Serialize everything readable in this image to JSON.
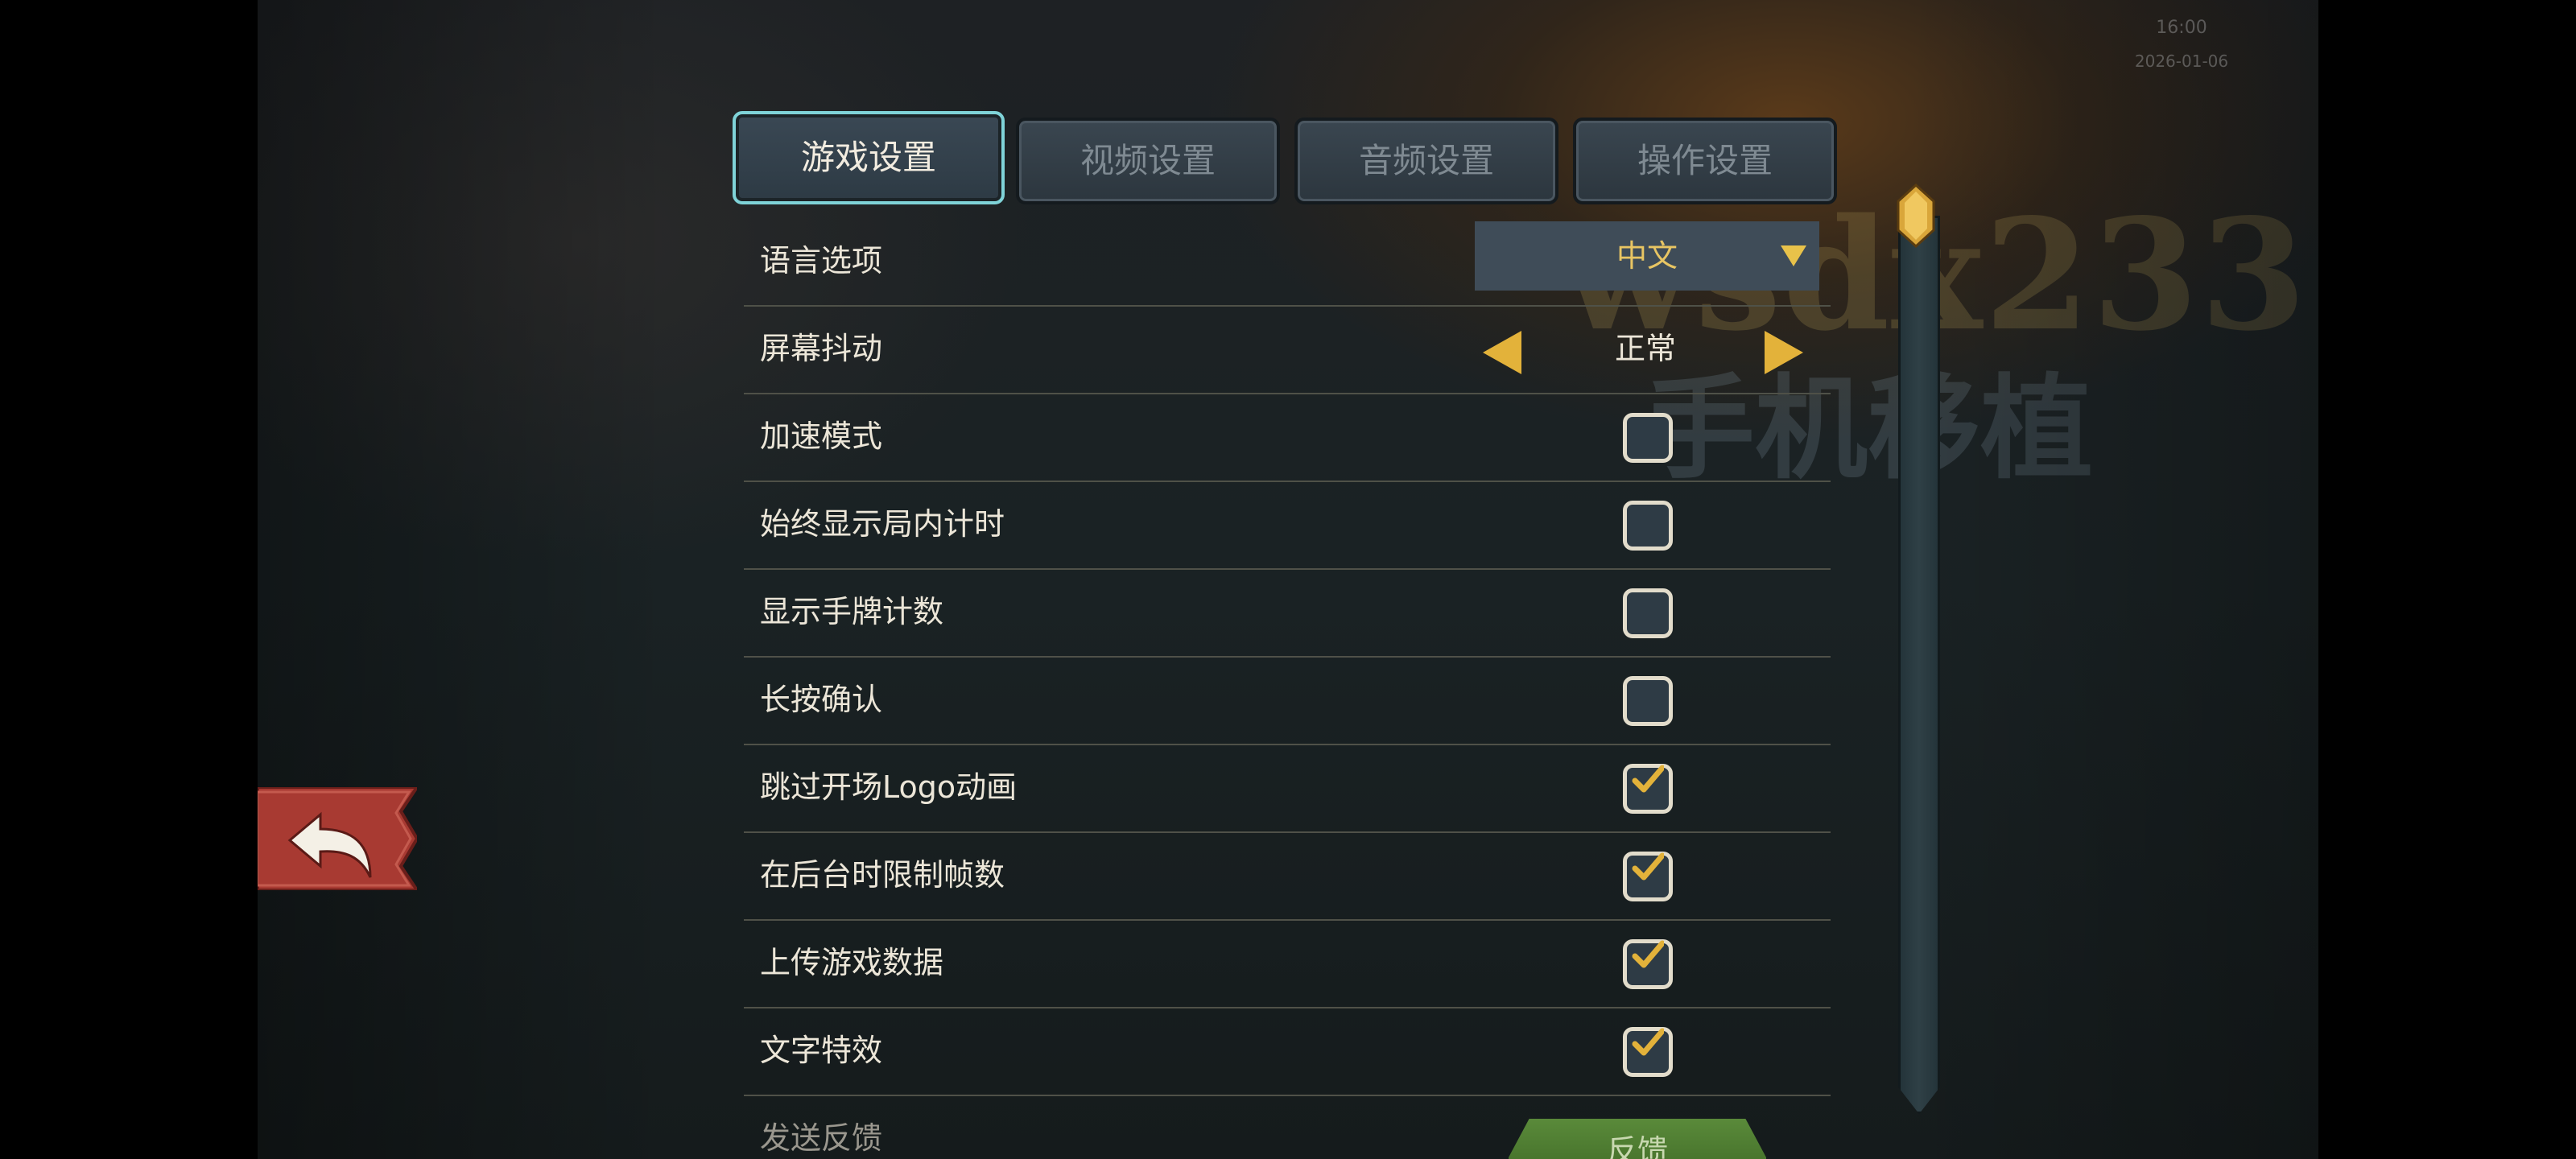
{
  "status": {
    "time": "16:00",
    "date": "2026-01-06"
  },
  "watermark": {
    "line1": "wsdx233",
    "line2": "手机移植"
  },
  "back_button": {
    "icon": "back-arrow-icon"
  },
  "tabs": [
    {
      "label": "游戏设置",
      "active": true
    },
    {
      "label": "视频设置",
      "active": false
    },
    {
      "label": "音频设置",
      "active": false
    },
    {
      "label": "操作设置",
      "active": false
    }
  ],
  "settings": {
    "language": {
      "label": "语言选项",
      "value": "中文"
    },
    "screen_shake": {
      "label": "屏幕抖动",
      "value": "正常"
    },
    "speed_mode": {
      "label": "加速模式",
      "checked": false
    },
    "always_show_timer": {
      "label": "始终显示局内计时",
      "checked": false
    },
    "show_hand_count": {
      "label": "显示手牌计数",
      "checked": false
    },
    "long_press_confirm": {
      "label": "长按确认",
      "checked": false
    },
    "skip_logo": {
      "label": "跳过开场Logo动画",
      "checked": true
    },
    "limit_fps_background": {
      "label": "在后台时限制帧数",
      "checked": true
    },
    "upload_data": {
      "label": "上传游戏数据",
      "checked": true
    },
    "text_effects": {
      "label": "文字特效",
      "checked": true
    },
    "feedback": {
      "label": "发送反馈",
      "button": "反馈"
    }
  },
  "colors": {
    "accent": "#e3b23a",
    "tab_active_border": "#7fd3d8",
    "feedback_green": "#4f7a30",
    "back_red": "#a83a32"
  }
}
